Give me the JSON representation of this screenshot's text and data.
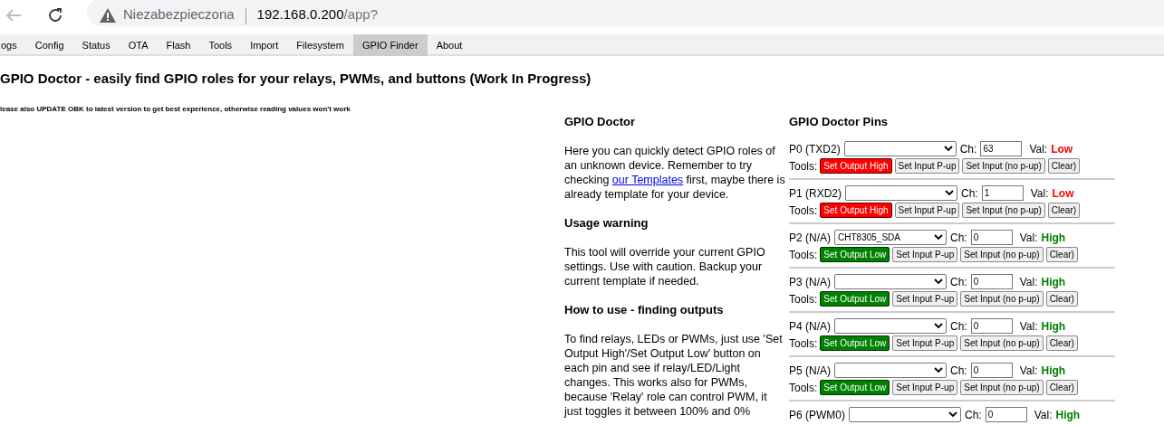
{
  "browser": {
    "security_label": "Niezabezpieczona",
    "url_host": "192.168.0.200",
    "url_path": "/app?"
  },
  "tabs": [
    {
      "label": "ogs",
      "selected": false
    },
    {
      "label": "Config",
      "selected": false
    },
    {
      "label": "Status",
      "selected": false
    },
    {
      "label": "OTA",
      "selected": false
    },
    {
      "label": "Flash",
      "selected": false
    },
    {
      "label": "Tools",
      "selected": false
    },
    {
      "label": "Import",
      "selected": false
    },
    {
      "label": "Filesystem",
      "selected": false
    },
    {
      "label": "GPIO Finder",
      "selected": true
    },
    {
      "label": "About",
      "selected": false
    }
  ],
  "heading": "GPIO Doctor - easily find GPIO roles for your relays, PWMs, and buttons (Work In Progress)",
  "note": "lease also UPDATE OBK to latest version to get best experience, otherwise reading values won't work",
  "info": {
    "title": "GPIO Doctor",
    "sections": [
      {
        "kind": "text",
        "before": "Here you can quickly detect GPIO roles of an unknown device. Remember to try checking ",
        "link": "our Templates",
        "after": " first, maybe there is already template for your device."
      },
      {
        "kind": "heading",
        "text": "Usage warning"
      },
      {
        "kind": "text",
        "before": "This tool will override your current GPIO settings. Use with caution. Backup your current template if needed."
      },
      {
        "kind": "heading",
        "text": "How to use - finding outputs"
      },
      {
        "kind": "text",
        "before": "To find relays, LEDs or PWMs, just use 'Set Output High'/Set Output Low' button on each pin and see if relay/LED/Light changes. This works also for PWMs, because 'Relay' role can control PWM, it just toggles it between 100% and 0%"
      }
    ]
  },
  "pins_title": "GPIO Doctor Pins",
  "pins": [
    {
      "label": "P0 (TXD2)",
      "ch_label": "Ch:",
      "ch": "63",
      "val_label": "Val:",
      "value": "Low",
      "color": "#ff0000",
      "tools_label": "Tools:",
      "buttons": [
        {
          "label": "Set Output High",
          "kind": "high"
        },
        {
          "label": "Set Input P-up",
          "kind": "plain"
        },
        {
          "label": "Set Input (no p-up)",
          "kind": "plain"
        },
        {
          "label": "Clear)",
          "kind": "plain"
        }
      ]
    },
    {
      "label": "P1 (RXD2)",
      "ch_label": "Ch:",
      "ch": "1",
      "val_label": "Val:",
      "value": "Low",
      "color": "#ff0000",
      "tools_label": "Tools:",
      "buttons": [
        {
          "label": "Set Output High",
          "kind": "high"
        },
        {
          "label": "Set Input P-up",
          "kind": "plain"
        },
        {
          "label": "Set Input (no p-up)",
          "kind": "plain"
        },
        {
          "label": "Clear)",
          "kind": "plain"
        }
      ]
    },
    {
      "label": "P2 (N/A)",
      "role": "CHT8305_SDA",
      "ch_label": "Ch:",
      "ch": "0",
      "val_label": "Val:",
      "value": "High",
      "color": "#008000",
      "tools_label": "Tools:",
      "buttons": [
        {
          "label": "Set Output Low",
          "kind": "low"
        },
        {
          "label": "Set Input P-up",
          "kind": "plain"
        },
        {
          "label": "Set Input (no p-up)",
          "kind": "plain"
        },
        {
          "label": "Clear)",
          "kind": "plain"
        }
      ]
    },
    {
      "label": "P3 (N/A)",
      "ch_label": "Ch:",
      "ch": "0",
      "val_label": "Val:",
      "value": "High",
      "color": "#008000",
      "tools_label": "Tools:",
      "buttons": [
        {
          "label": "Set Output Low",
          "kind": "low"
        },
        {
          "label": "Set Input P-up",
          "kind": "plain"
        },
        {
          "label": "Set Input (no p-up)",
          "kind": "plain"
        },
        {
          "label": "Clear)",
          "kind": "plain"
        }
      ]
    },
    {
      "label": "P4 (N/A)",
      "ch_label": "Ch:",
      "ch": "0",
      "val_label": "Val:",
      "value": "High",
      "color": "#008000",
      "tools_label": "Tools:",
      "buttons": [
        {
          "label": "Set Output Low",
          "kind": "low"
        },
        {
          "label": "Set Input P-up",
          "kind": "plain"
        },
        {
          "label": "Set Input (no p-up)",
          "kind": "plain"
        },
        {
          "label": "Clear)",
          "kind": "plain"
        }
      ]
    },
    {
      "label": "P5 (N/A)",
      "ch_label": "Ch:",
      "ch": "0",
      "val_label": "Val:",
      "value": "High",
      "color": "#008000",
      "tools_label": "Tools:",
      "buttons": [
        {
          "label": "Set Output Low",
          "kind": "low"
        },
        {
          "label": "Set Input P-up",
          "kind": "plain"
        },
        {
          "label": "Set Input (no p-up)",
          "kind": "plain"
        },
        {
          "label": "Clear)",
          "kind": "plain"
        }
      ]
    },
    {
      "label": "P6 (PWM0)",
      "ch_label": "Ch:",
      "ch": "0",
      "val_label": "Val:",
      "value": "High",
      "color": "#008000"
    }
  ]
}
